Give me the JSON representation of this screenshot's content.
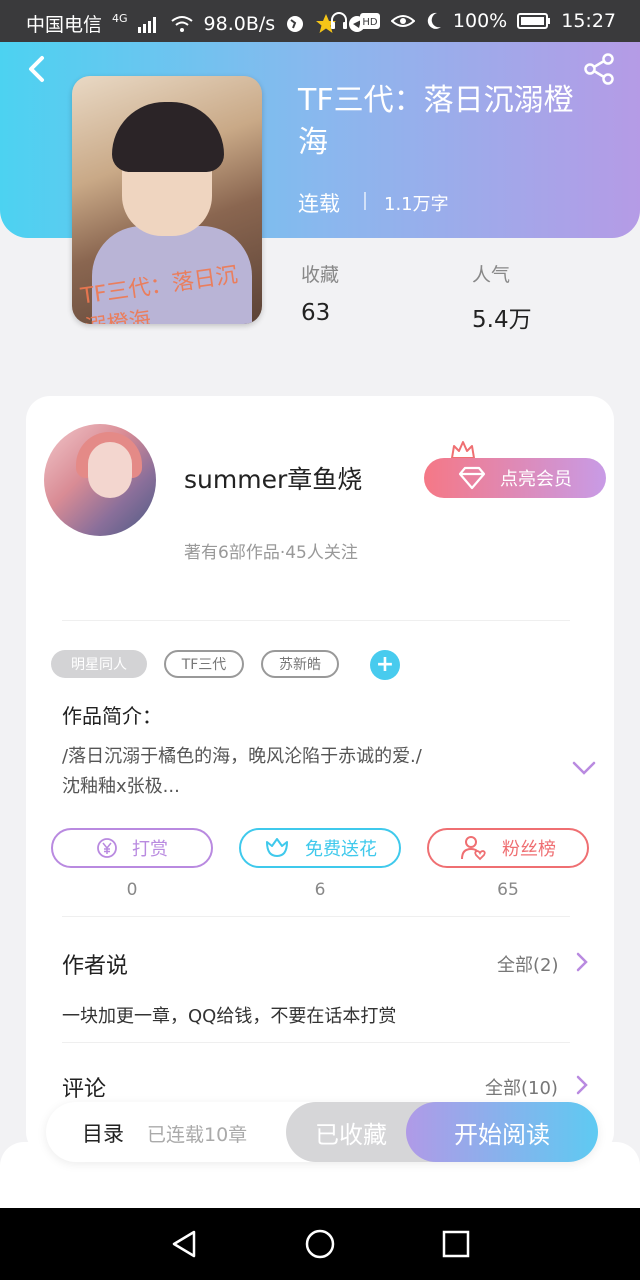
{
  "status_bar": {
    "carrier": "中国电信",
    "network": "4G",
    "speed": "98.0B/s",
    "battery": "100%",
    "time": "15:27"
  },
  "book": {
    "title": "TF三代：落日沉溺橙海",
    "status": "连载",
    "word_count": "1.1万字",
    "favorites_label": "收藏",
    "favorites_value": "63",
    "popularity_label": "人气",
    "popularity_value": "5.4万",
    "cover_text": "TF三代：落日沉溺橙海"
  },
  "author": {
    "name": "summer章鱼烧",
    "meta": "著有6部作品·45人关注",
    "vip_label": "点亮会员"
  },
  "tags": [
    "明星同人",
    "TF三代",
    "苏新皓"
  ],
  "intro": {
    "heading": "作品简介：",
    "text_line1": "/落日沉溺于橘色的海，晚风沦陷于赤诚的爱./",
    "text_line2": "沈釉釉x张极..."
  },
  "actions": [
    {
      "label": "打赏",
      "count": "0",
      "icon": "yen-coin-icon",
      "color": "#b98ae0"
    },
    {
      "label": "免费送花",
      "count": "6",
      "icon": "flower-icon",
      "color": "#3fc9ec"
    },
    {
      "label": "粉丝榜",
      "count": "65",
      "icon": "person-heart-icon",
      "color": "#ef6f72"
    }
  ],
  "author_says": {
    "heading": "作者说",
    "all": "全部(2)",
    "text": "一块加更一章，QQ给钱，不要在话本打赏"
  },
  "comments": {
    "heading": "评论",
    "all": "全部(10)"
  },
  "bottom": {
    "toc_label": "目录",
    "toc_meta": "已连载10章",
    "collected_label": "已收藏",
    "read_label": "开始阅读"
  },
  "colors": {
    "accent_blue": "#4cd2f1",
    "accent_purple": "#b59be6",
    "vip_pink": "#f57886"
  }
}
